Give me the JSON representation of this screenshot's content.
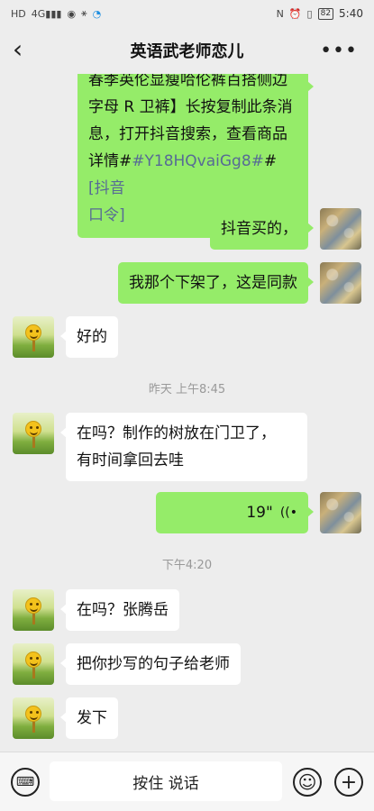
{
  "status_bar": {
    "left_icons": [
      "HD",
      "4G",
      "signal",
      "eye",
      "sync",
      "loop"
    ],
    "right_icons": [
      "nfc",
      "alarm",
      "vibrate"
    ],
    "battery": "82",
    "time": "5:40"
  },
  "nav": {
    "back_symbol": "‹",
    "title": "英语武老师恋儿",
    "more_symbol": "•••"
  },
  "messages": {
    "m1": {
      "sender": "me",
      "line0": "春季英伦显瘦哈伦裤百搭侧边",
      "line1": "字母 R 卫裤】长按复制此条消",
      "line2": "息，打开抖音搜索，查看商品",
      "line3_prefix": "详情#",
      "line3_link": "#Y18HQvaiGg8#",
      "line3_suffix": "#",
      "line3_link2": "[抖音",
      "line4_link": "口令]"
    },
    "m2": {
      "sender": "me",
      "text": "抖音买的，"
    },
    "m3": {
      "sender": "me",
      "text": "我那个下架了，这是同款"
    },
    "m4": {
      "sender": "them",
      "text": "好的"
    },
    "ts1": "昨天 上午8:45",
    "m5": {
      "sender": "them",
      "line1": "在吗？制作的树放在门卫了，",
      "line2": "有时间拿回去哇"
    },
    "m6": {
      "sender": "me",
      "type": "voice",
      "duration": "19\""
    },
    "ts2": "下午4:20",
    "m7": {
      "sender": "them",
      "text": "在吗？张腾岳"
    },
    "m8": {
      "sender": "them",
      "text": "把你抄写的句子给老师"
    },
    "m9": {
      "sender": "them",
      "text": "发下"
    }
  },
  "toolbar": {
    "hold_to_talk": "按住 说话",
    "keyboard_symbol": "⌨",
    "emoji_symbol": "☺",
    "plus_symbol": "+"
  }
}
